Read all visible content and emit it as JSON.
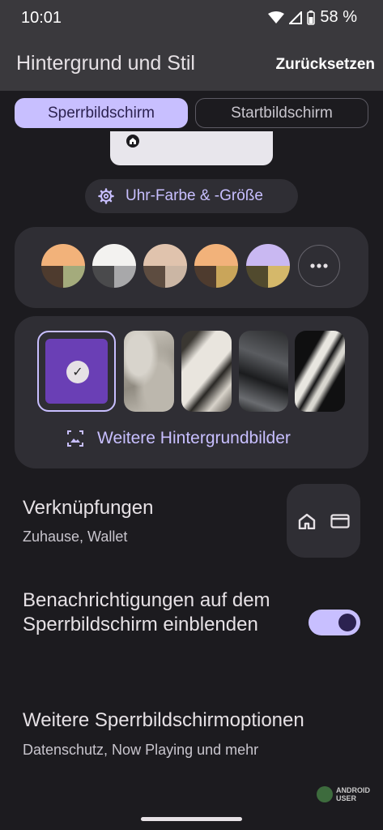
{
  "status": {
    "time": "10:01",
    "battery": "58 %"
  },
  "appbar": {
    "title": "Hintergrund und Stil",
    "reset_label": "Zurücksetzen"
  },
  "tabs": [
    {
      "label": "Sperrbildschirm",
      "selected": true
    },
    {
      "label": "Startbildschirm",
      "selected": false
    }
  ],
  "clock_chip": {
    "label": "Uhr-Farbe & -Größe"
  },
  "palettes": [
    {
      "top": "#f2b27a",
      "bottom_left": "#4e3b2e",
      "bottom_right": "#a4ab7c"
    },
    {
      "top": "#f3f2f0",
      "bottom_left": "#4a4a4c",
      "bottom_right": "#a8a8aa"
    },
    {
      "top": "#e0c3ad",
      "bottom_left": "#5d4c40",
      "bottom_right": "#cbb6a4"
    },
    {
      "top": "#f2b27a",
      "bottom_left": "#4e3b2e",
      "bottom_right": "#c9a55a"
    },
    {
      "top": "#c9b8f2",
      "bottom_left": "#514a2e",
      "bottom_right": "#d5b86a"
    }
  ],
  "wallpapers": {
    "more_label": "Weitere Hintergrundbilder"
  },
  "shortcuts": {
    "title": "Verknüpfungen",
    "subtitle": "Zuhause, Wallet"
  },
  "notifications": {
    "title": "Benachrichtigungen auf dem Sperrbildschirm einblenden",
    "enabled": true
  },
  "more_options": {
    "title": "Weitere Sperrbildschirmoptionen",
    "subtitle": "Datenschutz, Now Playing und mehr"
  },
  "watermark": {
    "line1": "ANDROID",
    "line2": "USER"
  },
  "colors": {
    "accent": "#c8bfff",
    "background": "#1c1b1f",
    "surface": "#2f2e34"
  }
}
